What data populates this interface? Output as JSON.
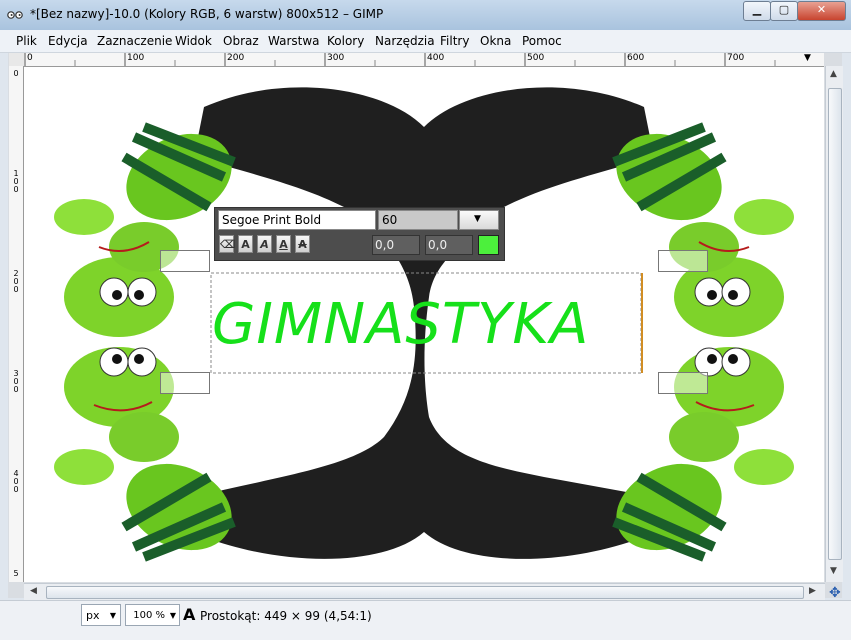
{
  "window": {
    "title": "*[Bez nazwy]-10.0 (Kolory RGB, 6 warstw) 800x512 – GIMP",
    "minimize_icon": "minimize-icon",
    "maximize_icon": "maximize-icon",
    "close_icon": "close-icon"
  },
  "menu": {
    "items": [
      "Plik",
      "Edycja",
      "Zaznaczenie",
      "Widok",
      "Obraz",
      "Warstwa",
      "Kolory",
      "Narzędzia",
      "Filtry",
      "Okna",
      "Pomoc"
    ]
  },
  "rulers": {
    "top": [
      "0",
      "100",
      "200",
      "300",
      "400",
      "500",
      "600",
      "700"
    ],
    "left": [
      "0",
      "1 0 0",
      "2 0 0",
      "3 0 0",
      "4 0 0",
      "5"
    ]
  },
  "canvas_text": "GIMNASTYKA",
  "text_tool": {
    "font": "Segoe Print Bold",
    "size": "60",
    "baseline": "0,0",
    "kerning": "0,0",
    "color": "#4cf03c",
    "style_buttons": [
      "A",
      "A",
      "A",
      "A"
    ]
  },
  "status": {
    "unit": "px",
    "zoom": "100 %",
    "info": "Prostokąt: 449 × 99  (4,54:1)"
  }
}
